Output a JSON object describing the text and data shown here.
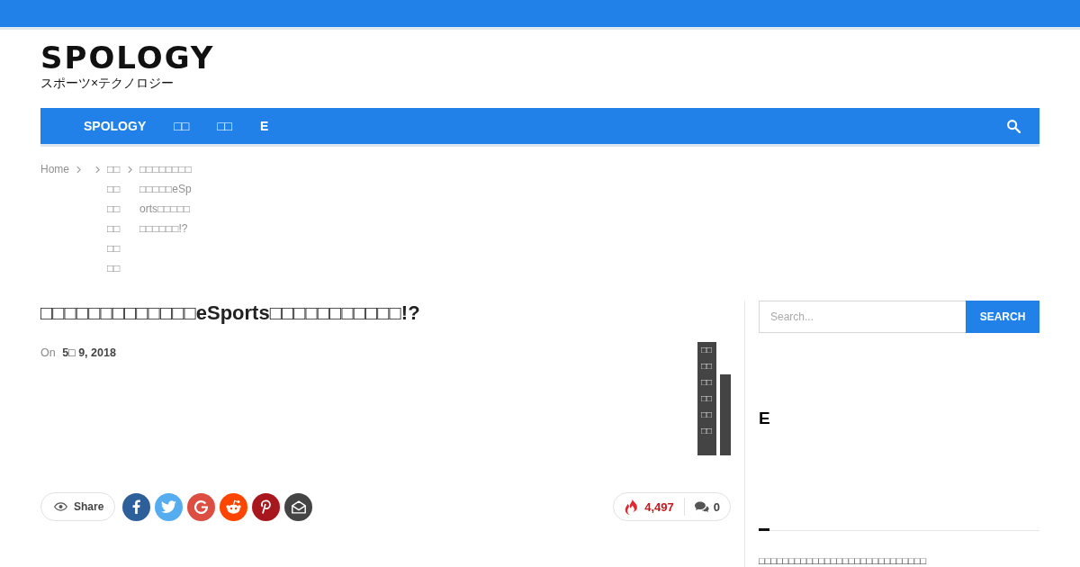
{
  "site": {
    "logo": "SPOLOGY",
    "tagline": "スポーツ×テクノロジー"
  },
  "nav": {
    "items": [
      {
        "label": "SPOLOGY"
      },
      {
        "label": "□□"
      },
      {
        "label": "□□"
      },
      {
        "label": "E"
      }
    ]
  },
  "breadcrumb": [
    {
      "kind": "home",
      "label": "Home"
    },
    {
      "kind": "blank"
    },
    {
      "kind": "link",
      "label": "□□□□□□ □□□□□□"
    },
    {
      "kind": "current",
      "label": "□□□□□□□□□□□□□eSports□□□□□□□□□□□!?"
    }
  ],
  "article": {
    "title": "□□□□□□□□□□□□□eSports□□□□□□□□□□□!?",
    "meta": {
      "prefix": "On",
      "date": "5□ 9, 2018"
    },
    "badges": [
      {
        "kind": "label",
        "label": "□□□□□□ □□□□□□"
      },
      {
        "kind": "bar"
      }
    ]
  },
  "share": {
    "label": "Share",
    "networks": [
      {
        "kind": "facebook",
        "color": "#2d5f9a"
      },
      {
        "kind": "twitter",
        "color": "#55acee"
      },
      {
        "kind": "google",
        "color": "#dc4e41"
      },
      {
        "kind": "reddit",
        "color": "#ff4500"
      },
      {
        "kind": "pinterest",
        "color": "#a8171d"
      },
      {
        "kind": "email",
        "color": "#444444"
      }
    ],
    "views": "4,497",
    "comments": "0"
  },
  "sidebar": {
    "search": {
      "placeholder": "Search...",
      "button": "SEARCH"
    },
    "widget_title": "E",
    "posts": [
      {
        "title": "□□□□□□□□□□□□□□□□□□□□□□□□□□□□"
      }
    ]
  }
}
